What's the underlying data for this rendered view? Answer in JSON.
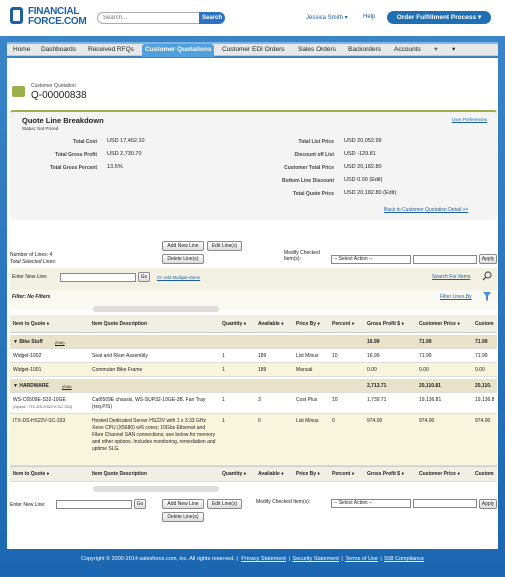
{
  "header": {
    "logo_line1": "FINANCIAL",
    "logo_line2": "FORCE.COM",
    "search_placeholder": "Search...",
    "search_button": "Search",
    "user_menu": "Jessica Smith ▾",
    "help": "Help",
    "app_switcher": "Order Fulfillment Process ▾"
  },
  "tabs": [
    "Home",
    "Dashboards",
    "Received RFQs",
    "Customer Quotations",
    "Customer EDI Orders",
    "Sales Orders",
    "Backorders",
    "Accounts",
    "+",
    "▾"
  ],
  "active_tab": "Customer Quotations",
  "record": {
    "type_label": "Customer Quotation",
    "number": "Q-00000838"
  },
  "breakdown": {
    "title": "Quote Line Breakdown",
    "status": "Status: Not Priced",
    "user_prefs": "User Preferences",
    "left": [
      {
        "label": "Total Cost",
        "value": "USD 17,452.10"
      },
      {
        "label": "Total Gross Profit",
        "value": "USD 2,730.70"
      },
      {
        "label": "Total Gross Percent",
        "value": "13.5%"
      }
    ],
    "right": [
      {
        "label": "Total List Price",
        "value": "USD 20,052.99"
      },
      {
        "label": "Discount off List",
        "value": "USD -129.81"
      },
      {
        "label": "Customer Total Price",
        "value": "USD 20,182.80"
      },
      {
        "label": "Bottom Line Discount",
        "value": "USD 0.00  (Edit)"
      },
      {
        "label": "Total Quote Price",
        "value": "USD 20,182.80  (Edit)"
      }
    ],
    "back_link": "Back to Customer Quotation Detail >>"
  },
  "toolbar": {
    "num_lines": "Number of Lines:  4",
    "selected_lines": "Total Selected Lines:",
    "add_new_line": "Add New Line",
    "edit_lines": "Edit Line(s)",
    "delete_lines": "Delete Line(s)",
    "modify_checked": "Modify Checked Item(s):",
    "modify_checked_bottom": "Modify Checked Item(s):",
    "select_action": "-- Select Action --",
    "apply": "Apply",
    "enter_new_line": "Enter New Line:",
    "go": "Go",
    "add_multiple": "Or Add Multiple Items",
    "search_items": "Search For Items",
    "filter": "Filter: No Filters",
    "filter_by": "Filter Lines By"
  },
  "table": {
    "headers": [
      "Item to Quote ♦",
      "Item Quote Description",
      "Quantity ♦",
      "Available ♦",
      "Price By ♦",
      "Percent ♦",
      "Gross Profit $ ♦",
      "Customer Price ♦",
      "Custom"
    ],
    "groups": [
      {
        "name": "▼ Bike Stuff",
        "edit": "(Edit)",
        "gross": "16.99",
        "customer": "71.99",
        "custom": "71.99",
        "rows": [
          {
            "item": "Widget-1002",
            "desc": "Seat and Riser Assembly",
            "qty": "1",
            "avail": "189",
            "price_by": "List Minus",
            "pct": "10",
            "gross": "16.99",
            "customer": "71.99",
            "custom": "71.99"
          },
          {
            "item": "Widget-1001",
            "desc": "Commuter Bike Frame",
            "qty": "1",
            "avail": "189",
            "price_by": "Manual",
            "pct": "",
            "gross": "0.00",
            "customer": "0.00",
            "custom": "0.00"
          }
        ]
      },
      {
        "name": "▼ HARDWARE",
        "edit": "(Edit)",
        "gross": "2,713.71",
        "customer": "20,110.81",
        "custom": "20,110.",
        "rows": [
          {
            "item": "WS-C6509E-S32-10GE",
            "item_sub": "(Upsell - ITX-DS-HS22V-SC-333)",
            "desc": "Cat6509E chassis, WS-SUP32-10GE-3B, Fan Tray (req.P/S)",
            "qty": "1",
            "avail": "3",
            "price_by": "Cost Plus",
            "pct": "10",
            "gross": "1,739.71",
            "customer": "19,136.81",
            "custom": "19,136.8"
          },
          {
            "item": "ITX-DS-HS22V-SC-333",
            "desc": "Hosted Dedicated Server HS22V with 1 x 3.33 GHz Xeon CPU (X5680) w/6 cores; 10Gbs Ethernet and Fibre Channel SAN connections; see below for memory and other options. Includes monitoring, remediation and uptime SLG.",
            "qty": "1",
            "avail": "0",
            "price_by": "List Minus",
            "pct": "0",
            "gross": "974.00",
            "customer": "974.00",
            "custom": "974.00"
          }
        ]
      }
    ]
  },
  "footer": {
    "copyright": "Copyright © 2000-2014 salesforce.com, inc. All rights reserved. |",
    "links": [
      "Privacy Statement",
      "Security Statement",
      "Terms of Use",
      "508 Compliance"
    ]
  },
  "colors": {
    "brand_blue": "#1f6fb5",
    "active_tab": "#4fa0dc",
    "panel_accent": "#9cb04a",
    "group_row": "#e7e2c8"
  }
}
